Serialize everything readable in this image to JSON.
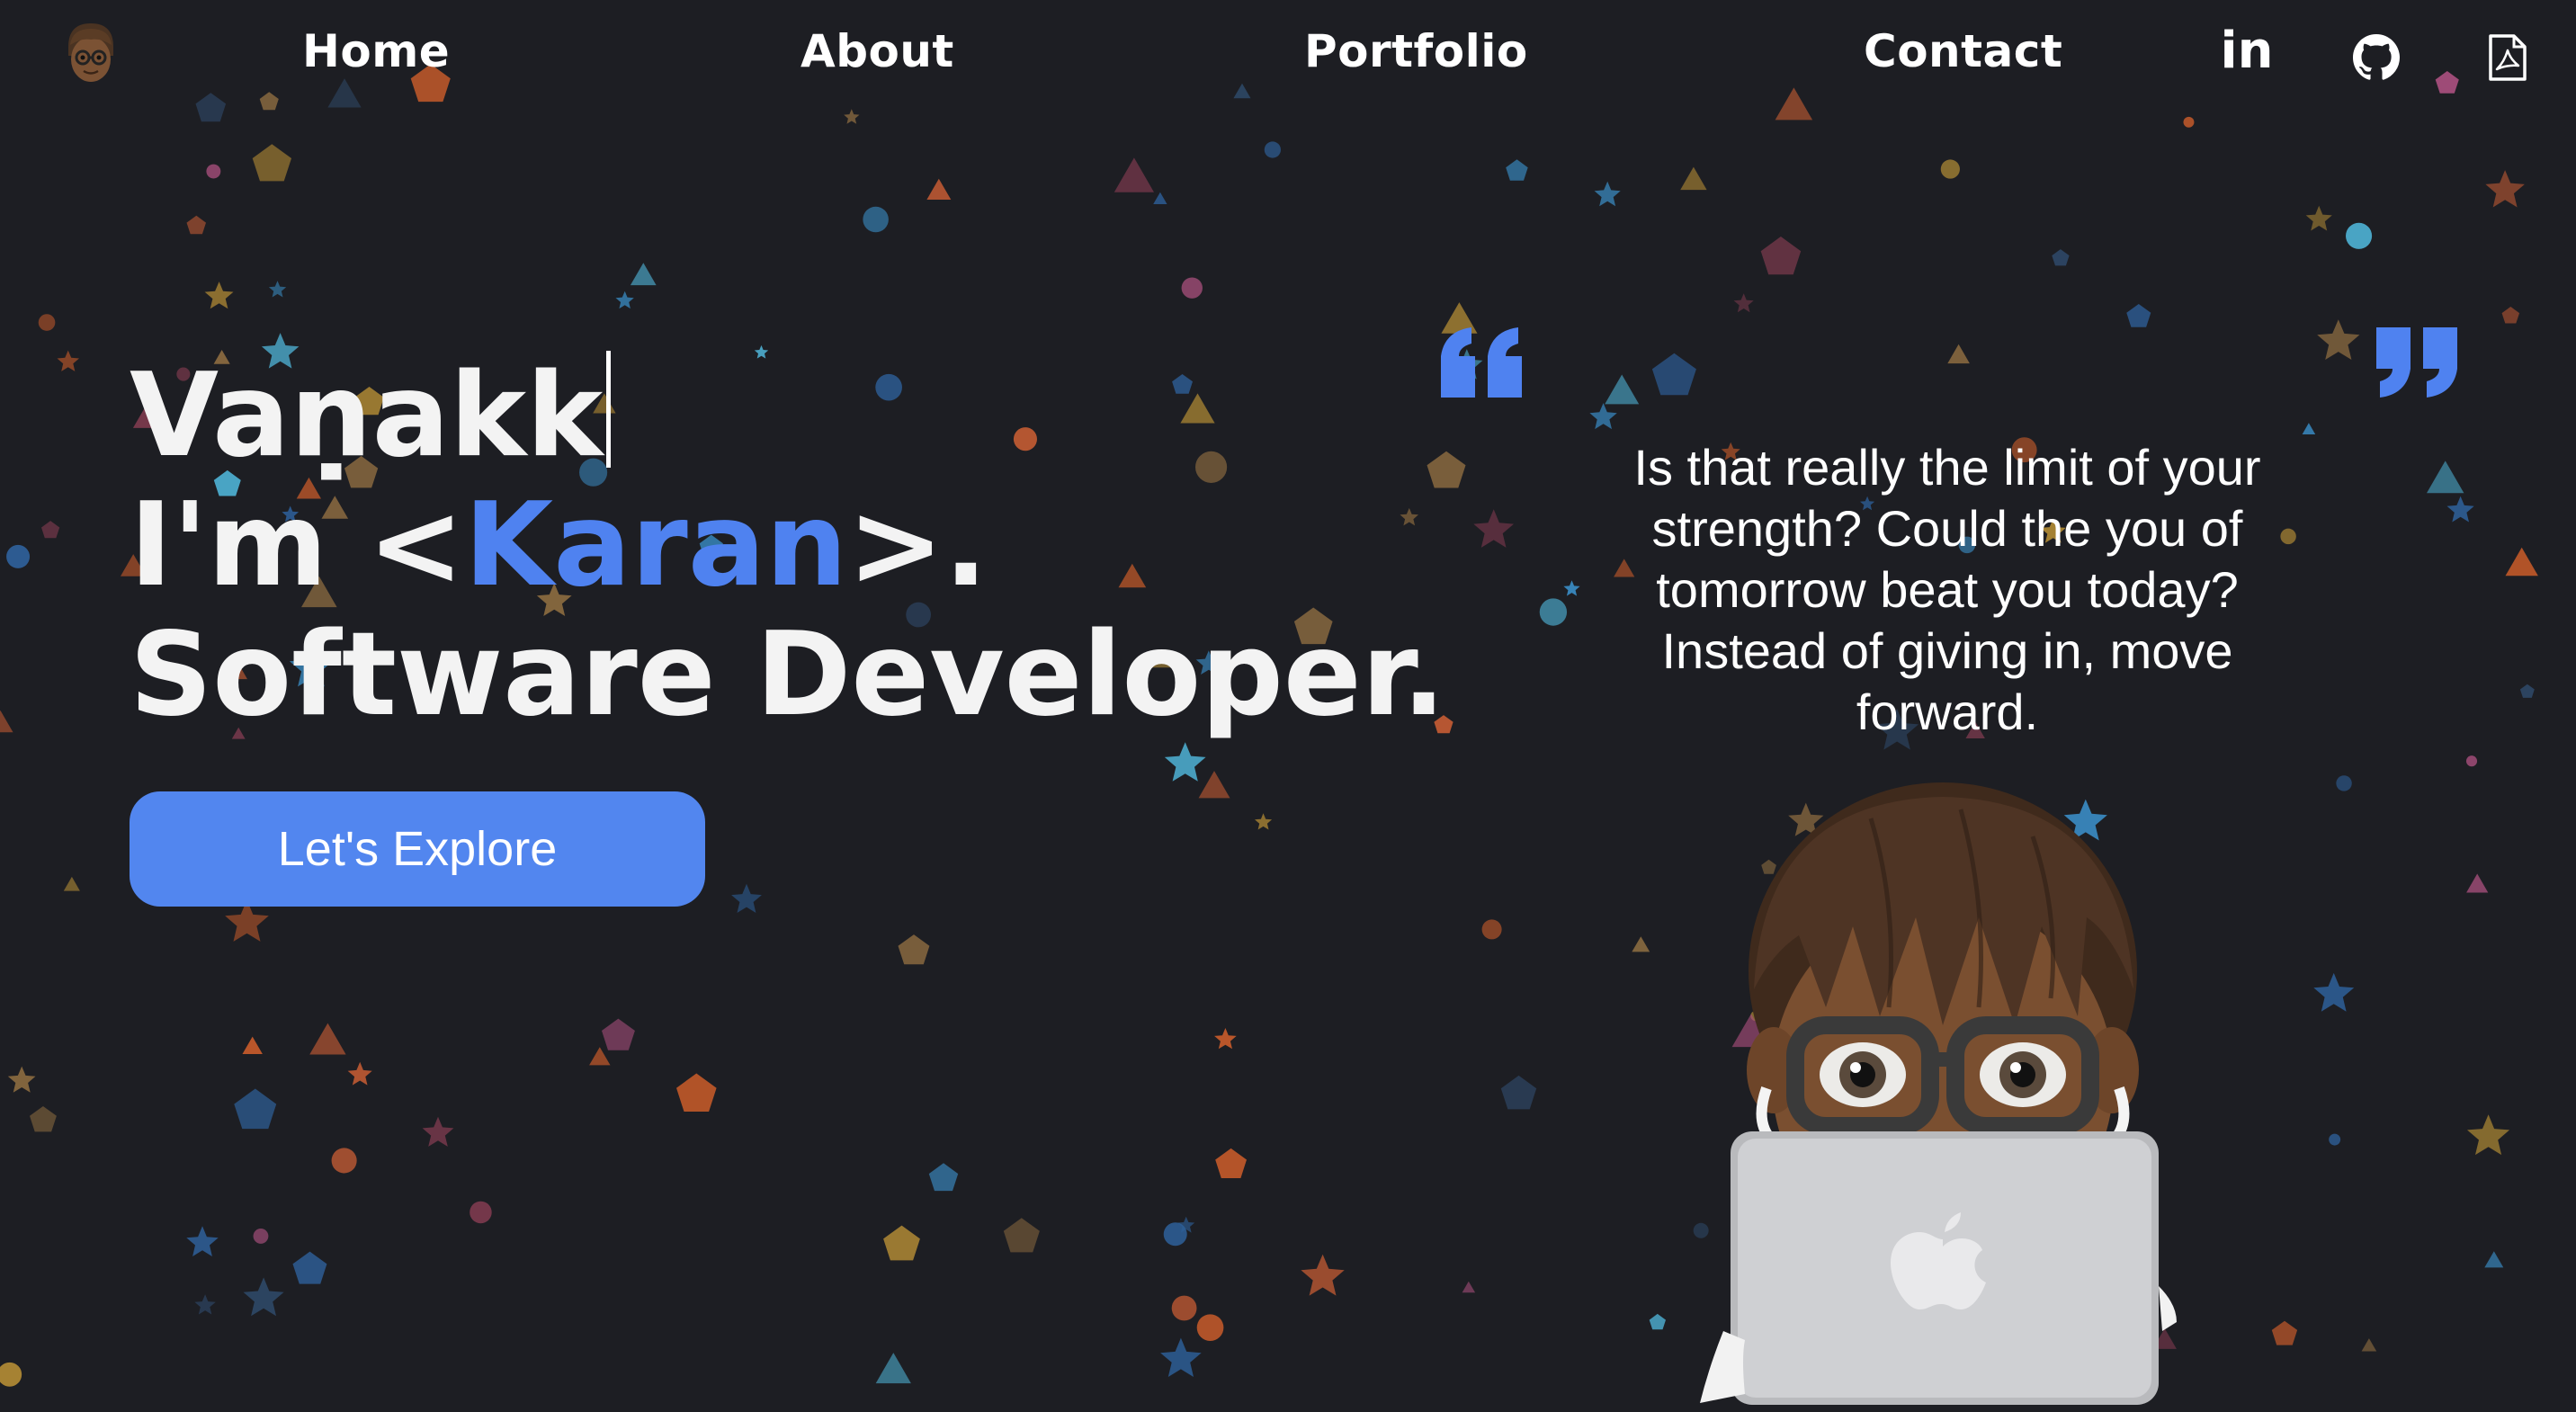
{
  "nav": {
    "links": [
      {
        "id": "home",
        "label": "Home"
      },
      {
        "id": "about",
        "label": "About"
      },
      {
        "id": "portfolio",
        "label": "Portfolio"
      },
      {
        "id": "contact",
        "label": "Contact"
      }
    ],
    "social": {
      "linkedin_label": "in",
      "linkedin_icon": "linkedin-icon",
      "github_icon": "github-icon",
      "resume_icon": "pdf-file-icon"
    }
  },
  "hero": {
    "greeting": "Vaṇakk",
    "intro_prefix": "I'm <",
    "name": "Karan",
    "intro_suffix": ">.",
    "role": "Software Developer."
  },
  "cta": {
    "label": "Let's Explore"
  },
  "quote": {
    "text": "Is that really the limit of your strength? Could the you of tomorrow beat you today? Instead of giving in, move forward."
  },
  "colors": {
    "background": "#1d1e23",
    "accent": "#4f82f0",
    "button": "#5286ef",
    "text": "#ffffff"
  }
}
